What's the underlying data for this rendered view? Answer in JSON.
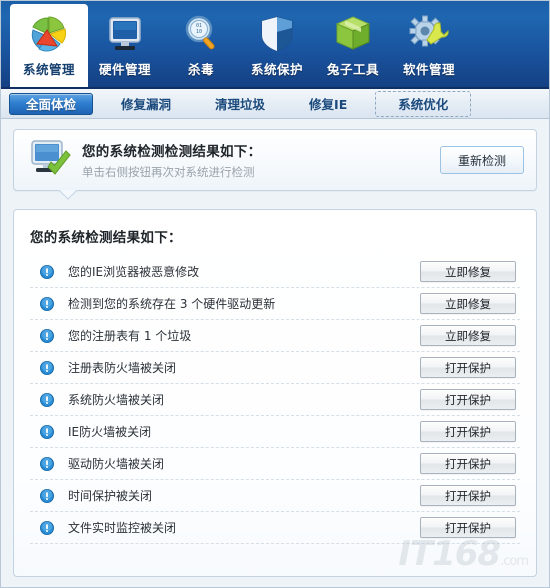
{
  "toolbar": {
    "items": [
      {
        "label": "系统管理",
        "icon": "pie-chart-icon",
        "active": true
      },
      {
        "label": "硬件管理",
        "icon": "monitor-icon",
        "active": false
      },
      {
        "label": "杀毒",
        "icon": "magnifier-icon",
        "active": false
      },
      {
        "label": "系统保护",
        "icon": "shield-icon",
        "active": false
      },
      {
        "label": "兔子工具",
        "icon": "green-box-icon",
        "active": false
      },
      {
        "label": "软件管理",
        "icon": "gear-wrench-icon",
        "active": false
      }
    ]
  },
  "tabs": [
    {
      "label": "全面体检",
      "state": "active"
    },
    {
      "label": "修复漏洞",
      "state": "normal"
    },
    {
      "label": "清理垃圾",
      "state": "normal"
    },
    {
      "label": "修复IE",
      "state": "normal"
    },
    {
      "label": "系统优化",
      "state": "dashed"
    }
  ],
  "banner": {
    "icon": "monitor-check-icon",
    "title": "您的系统检测检测结果如下：",
    "subtitle": "单击右侧按钮再次对系统进行检测",
    "rescan_label": "重新检测"
  },
  "results": {
    "title": "您的系统检测结果如下：",
    "rows": [
      {
        "icon": "info-exclamation-icon",
        "text": "您的IE浏览器被恶意修改",
        "action": "立即修复"
      },
      {
        "icon": "info-exclamation-icon",
        "text": "检测到您的系统存在 3 个硬件驱动更新",
        "action": "立即修复"
      },
      {
        "icon": "info-exclamation-icon",
        "text": "您的注册表有 1 个垃圾",
        "action": "立即修复"
      },
      {
        "icon": "info-exclamation-icon",
        "text": "注册表防火墙被关闭",
        "action": "打开保护"
      },
      {
        "icon": "info-exclamation-icon",
        "text": "系统防火墙被关闭",
        "action": "打开保护"
      },
      {
        "icon": "info-exclamation-icon",
        "text": "IE防火墙被关闭",
        "action": "打开保护"
      },
      {
        "icon": "info-exclamation-icon",
        "text": "驱动防火墙被关闭",
        "action": "打开保护"
      },
      {
        "icon": "info-exclamation-icon",
        "text": "时间保护被关闭",
        "action": "打开保护"
      },
      {
        "icon": "info-exclamation-icon",
        "text": "文件实时监控被关闭",
        "action": "打开保护"
      }
    ]
  },
  "watermark": {
    "text": "IT168",
    "suffix": ".com"
  },
  "colors": {
    "toolbar_blue": "#1a55a0",
    "tab_active_blue": "#2f7fd0",
    "panel_border": "#c3d3e2",
    "info_icon_blue": "#2a8fd8",
    "text_dark": "#2b3138",
    "subtitle_gray": "#9aa3ab"
  }
}
